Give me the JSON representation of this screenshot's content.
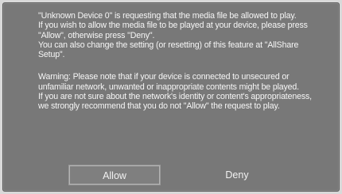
{
  "dialog": {
    "paragraph1": [
      "\"Unknown Device 0\" is requesting that the media file be allowed to play.",
      "If you wish to allow the media file to be played at your device, please press",
      "\"Allow\", otherwise press \"Deny\".",
      "You can also change the setting (or resetting) of this feature at \"AllShare",
      "Setup\"."
    ],
    "paragraph2": [
      "Warning: Please note that if your device is connected to unsecured or",
      "unfamiliar network, unwanted or inappropriate contents might be played.",
      "If you are not sure about the network's identity or content's appropriateness,",
      "we strongly recommend that you do not \"Allow\" the request to play."
    ],
    "allow_label": "Allow",
    "deny_label": "Deny",
    "colors": {
      "panel": "#787878",
      "text": "#f6f6f6",
      "focus_border": "#b4b4b4"
    }
  }
}
